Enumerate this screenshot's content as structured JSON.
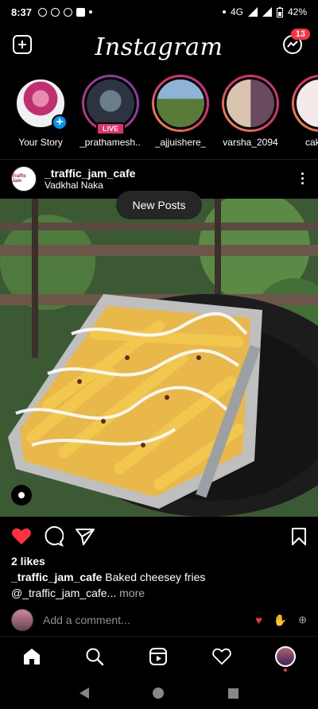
{
  "status_bar": {
    "time": "8:37",
    "network": "4G",
    "battery": "42%"
  },
  "header": {
    "logo": "Instagram",
    "message_badge": "13"
  },
  "stories": [
    {
      "label": "Your Story",
      "live": false,
      "own": true
    },
    {
      "label": "_prathamesh...",
      "live": true,
      "live_label": "LIVE"
    },
    {
      "label": "_ajjuishere_",
      "live": false
    },
    {
      "label": "varsha_2094",
      "live": false
    },
    {
      "label": "cakesb",
      "live": false
    }
  ],
  "post": {
    "username": "_traffic_jam_cafe",
    "location": "Vadkhal Naka",
    "avatar_text": "Traffic Jam",
    "new_posts_pill": "New Posts",
    "likes": "2 likes",
    "caption_user": "_traffic_jam_cafe",
    "caption_text": " Baked cheesey fries",
    "caption_line2": "@_traffic_jam_cafe...",
    "more_label": " more",
    "comment_placeholder": "Add a comment..."
  },
  "colors": {
    "like_red": "#ff3040",
    "story_ring": "#e1306c",
    "badge": "#ff3040"
  }
}
